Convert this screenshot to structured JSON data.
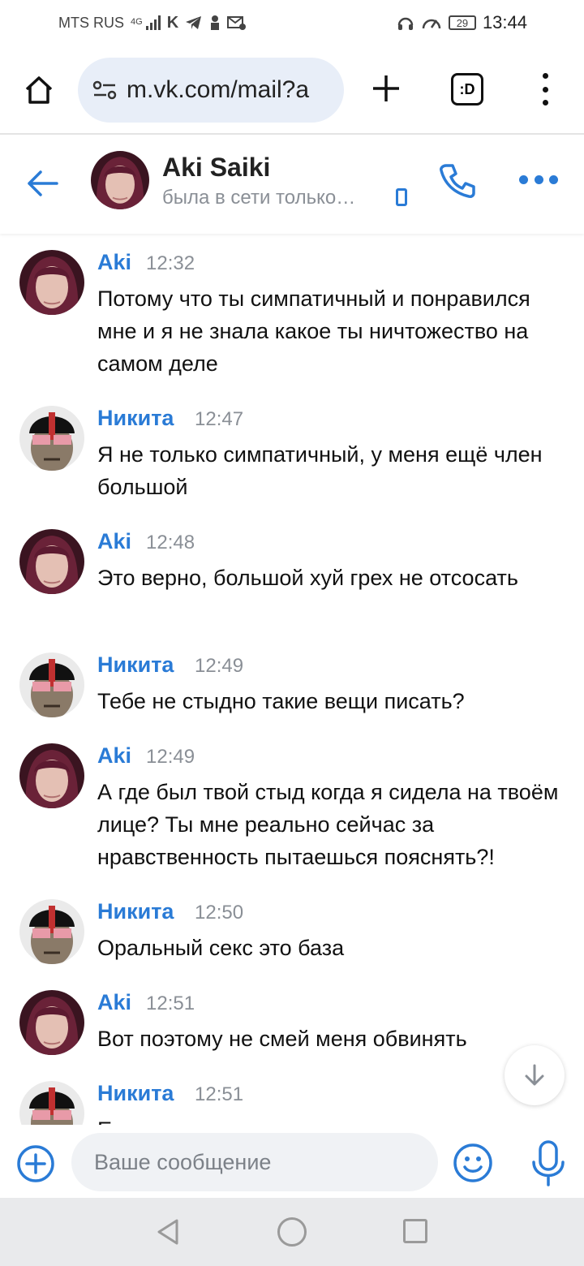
{
  "status_bar": {
    "carrier": "MTS RUS",
    "network": "4G",
    "battery": "29",
    "time": "13:44"
  },
  "browser": {
    "url": "m.vk.com/mail?a",
    "tabs_label": ":D"
  },
  "chat": {
    "name": "Aki Saiki",
    "status": "была в сети только…"
  },
  "messages": [
    {
      "author": "Aki",
      "time": "12:32",
      "text": "Потому что ты симпатичный и понравился мне и я не знала какое ты ничтожество на самом деле",
      "avatar": "aki"
    },
    {
      "author": "Никита",
      "time": "12:47",
      "text": "Я не только симпатичный, у меня ещё член большой",
      "avatar": "nikita"
    },
    {
      "author": "Aki",
      "time": "12:48",
      "text": "Это верно, большой хуй грех не отсосать",
      "avatar": "aki"
    },
    {
      "author": "Никита",
      "time": "12:49",
      "text": "Тебе не стыдно такие вещи писать?",
      "avatar": "nikita"
    },
    {
      "author": "Aki",
      "time": "12:49",
      "text": "А где был твой стыд когда я сидела на твоём лице? Ты мне реально сейчас за нравственность пытаешься пояснять?!",
      "avatar": "aki"
    },
    {
      "author": "Никита",
      "time": "12:50",
      "text": "Оральный секс это база",
      "avatar": "nikita"
    },
    {
      "author": "Aki",
      "time": "12:51",
      "text": "Вот поэтому не смей меня обвинять",
      "avatar": "aki"
    },
    {
      "author": "Никита",
      "time": "12:51",
      "text": "Если мы трахались, то это значит, что",
      "avatar": "nikita"
    }
  ],
  "composer": {
    "placeholder": "Ваше сообщение"
  },
  "colors": {
    "accent": "#2a7bd6",
    "meta": "#8a8f96",
    "input_bg": "#f0f2f5",
    "url_bg": "#e8eef8"
  }
}
